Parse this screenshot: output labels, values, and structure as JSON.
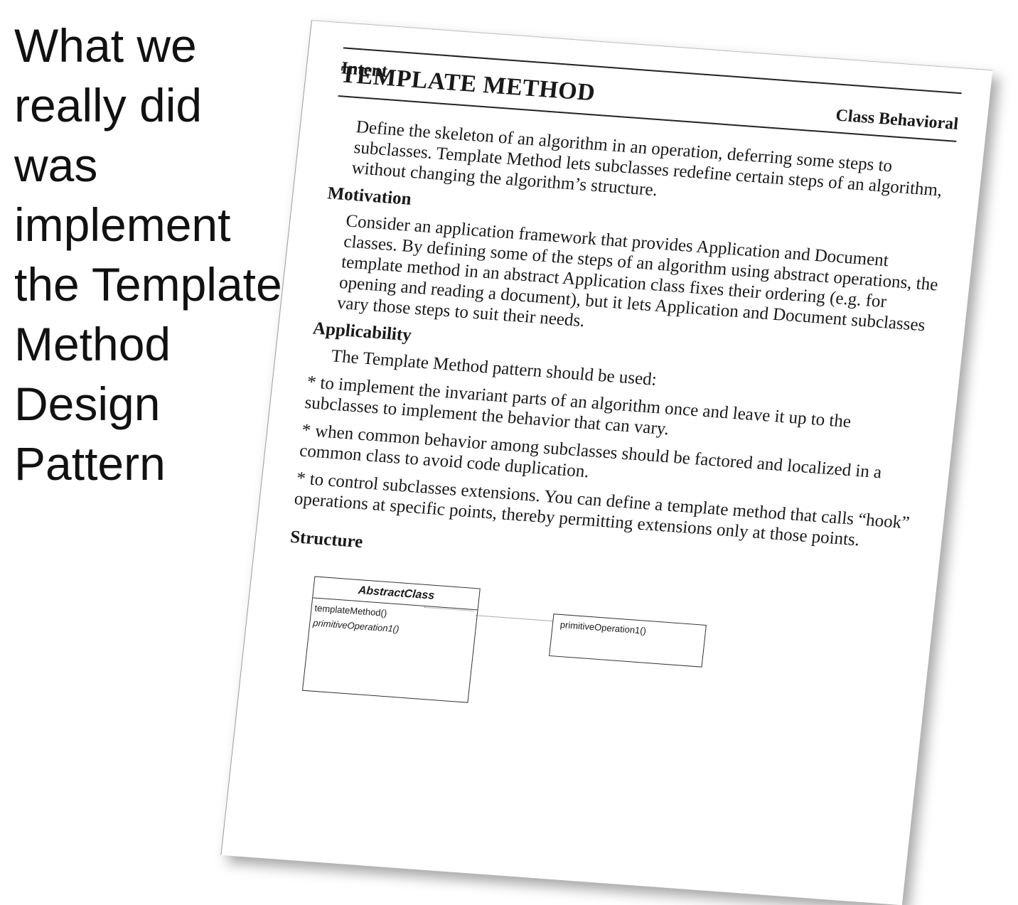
{
  "slide": {
    "title_lines": [
      "What we",
      "really did",
      "was",
      "implement",
      "the Template",
      "Method",
      "Design",
      "Pattern"
    ]
  },
  "document": {
    "title": "TEMPLATE METHOD",
    "category": "Class Behavioral",
    "sections": {
      "intent": {
        "heading": "Intent",
        "text": "Define the skeleton of an algorithm in an operation, deferring some steps to subclasses. Template Method lets subclasses redefine certain steps of an algorithm, without changing the algorithm’s structure."
      },
      "motivation": {
        "heading": "Motivation",
        "text": "Consider an application framework that provides Application and Document classes. By defining some of the steps of an algorithm using abstract operations, the template method in an abstract Application class fixes their ordering (e.g. for opening and reading a document), but it lets Application and Document subclasses vary those steps to suit their needs."
      },
      "applicability": {
        "heading": "Applicability",
        "intro": "The Template Method pattern should be used:",
        "bullets": [
          "* to implement the invariant parts of an algorithm once and leave it up to the subclasses to implement the behavior that can vary.",
          "* when common behavior among subclasses should be factored and localized in a common class to avoid code duplication.",
          "* to control subclasses extensions. You can define a template method that calls “hook” operations at specific points, thereby permitting extensions only at those points."
        ]
      },
      "structure": {
        "heading": "Structure",
        "diagram": {
          "class_name": "AbstractClass",
          "operations": [
            "templateMethod()",
            "primitiveOperation1()"
          ],
          "note_text": "primitiveOperation1()"
        }
      }
    }
  }
}
